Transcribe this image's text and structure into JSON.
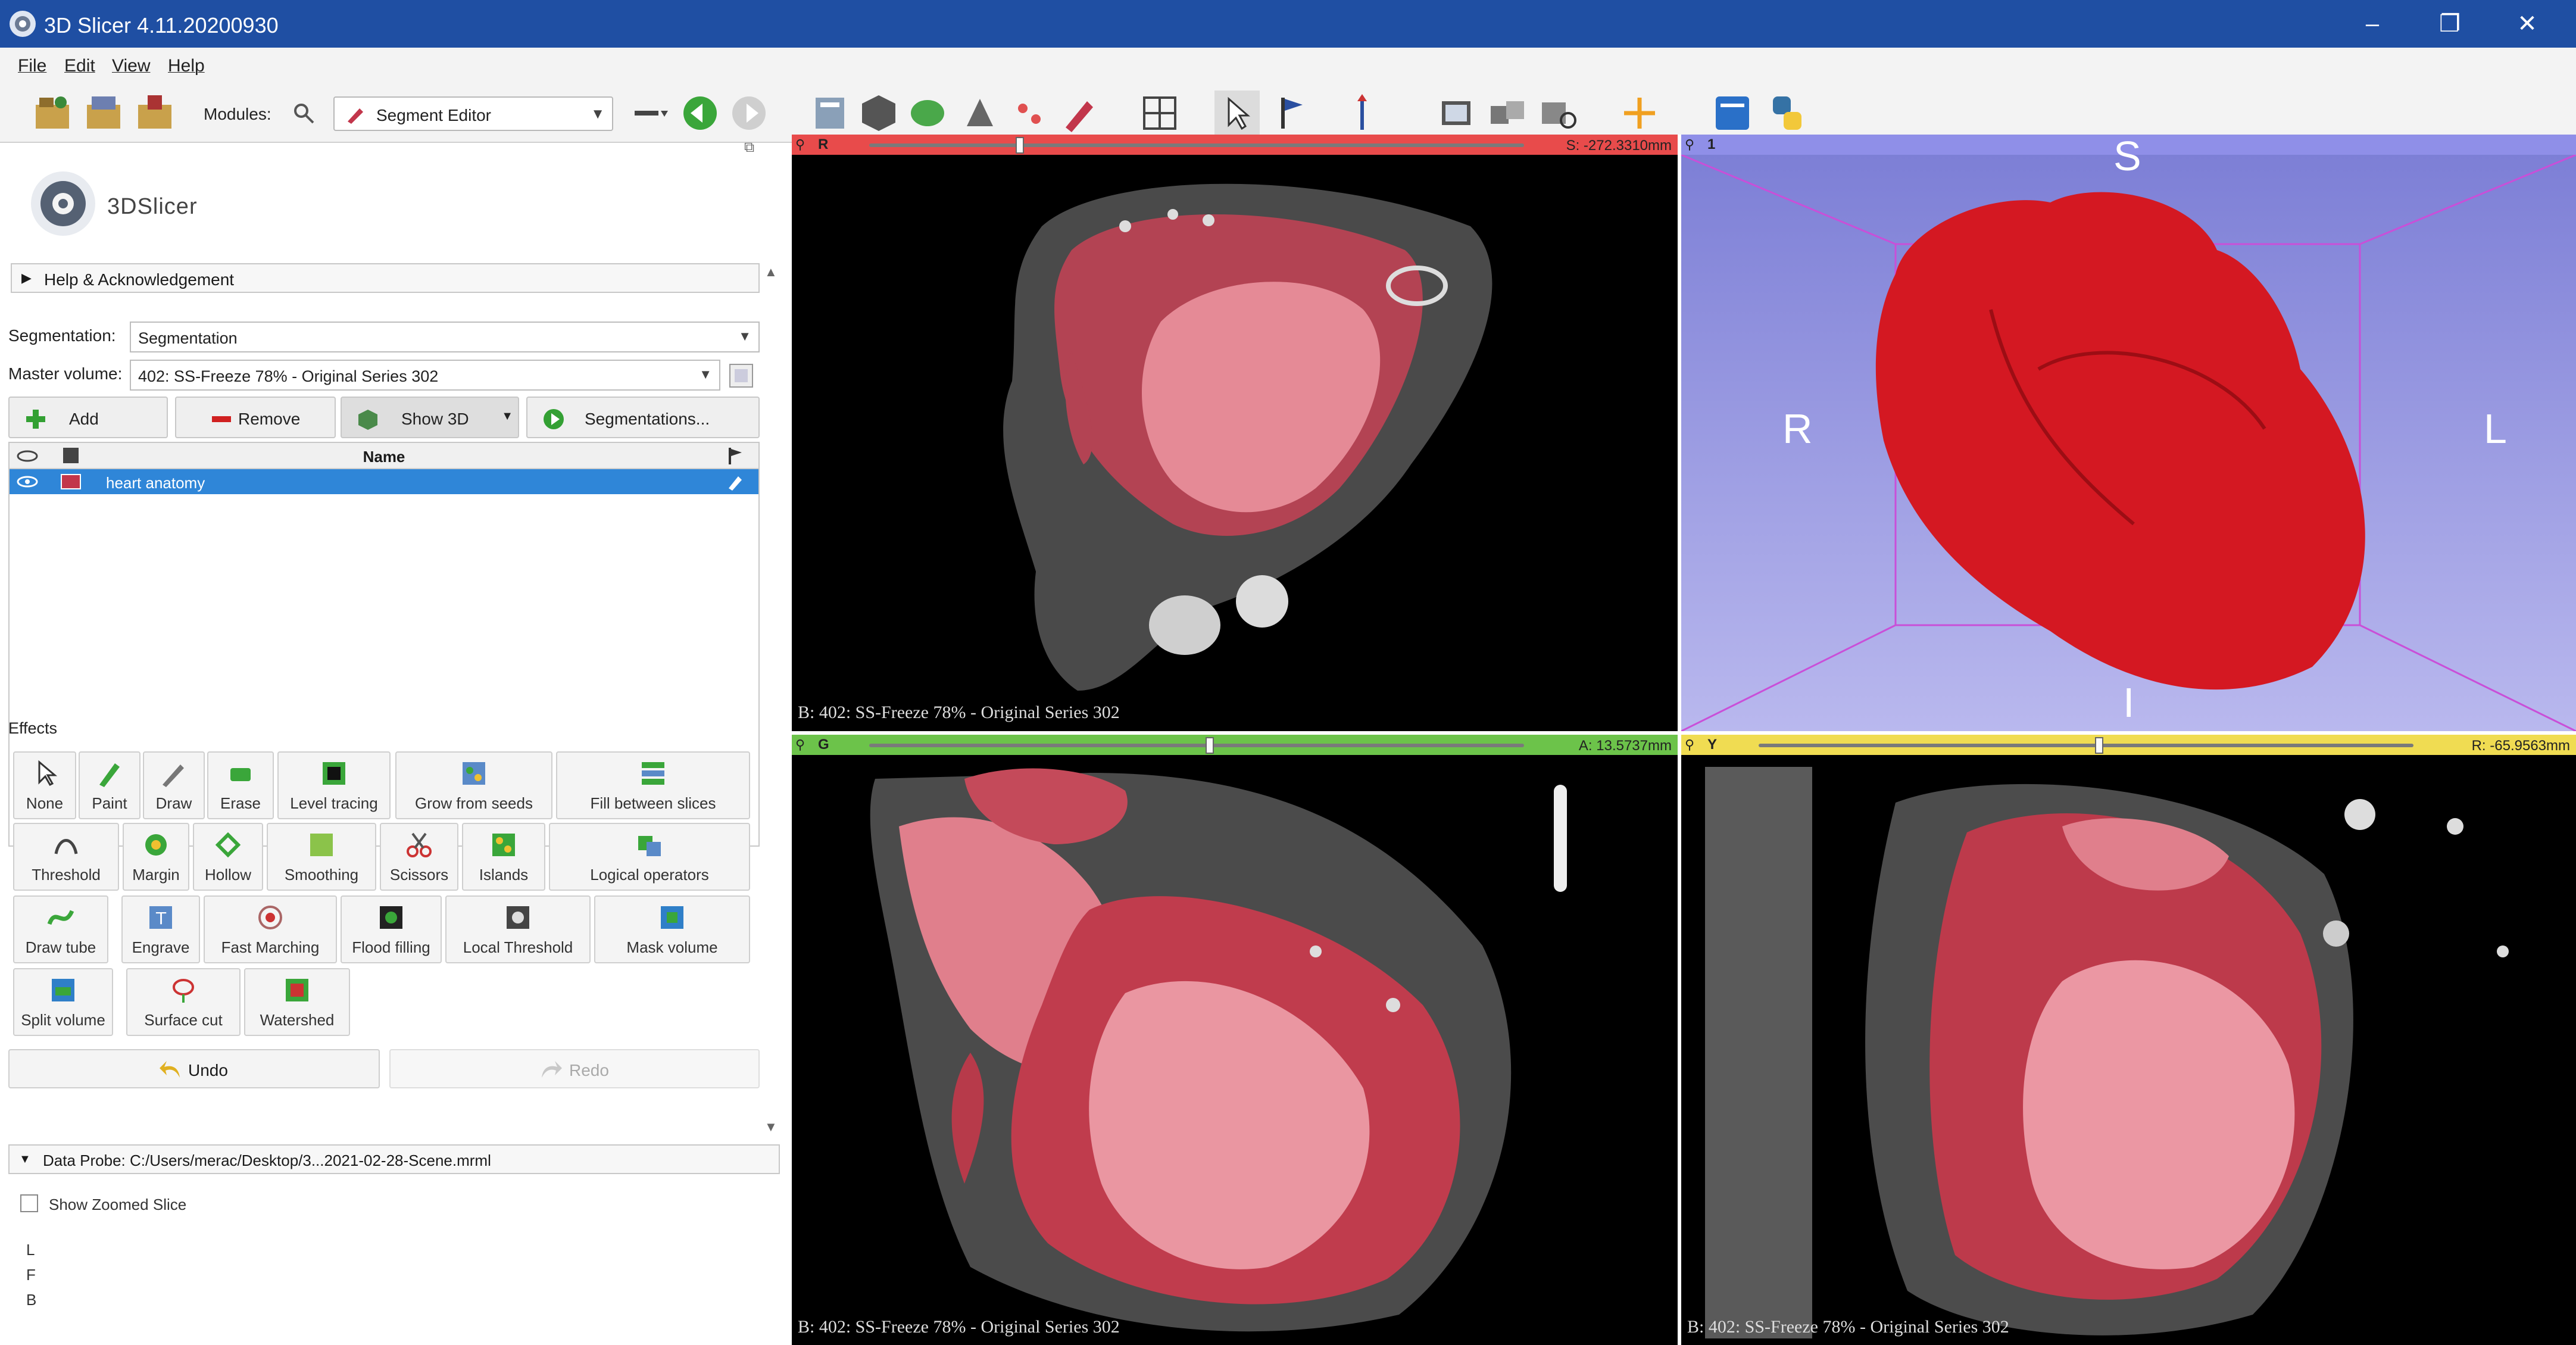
{
  "window": {
    "title": "3D Slicer 4.11.20200930",
    "minimize": "–",
    "maximize": "❐",
    "close": "✕"
  },
  "menu": [
    "File",
    "Edit",
    "View",
    "Help"
  ],
  "toolbar": {
    "modules_label": "Modules:",
    "module_selected": "Segment Editor"
  },
  "logo_text": "3DSlicer",
  "help_section": "Help & Acknowledgement",
  "segmentation": {
    "label": "Segmentation:",
    "value": "Segmentation"
  },
  "master_volume": {
    "label": "Master volume:",
    "value": "402: SS-Freeze 78% - Original Series 302"
  },
  "buttons": {
    "add": "Add",
    "remove": "Remove",
    "show3d": "Show 3D",
    "segmentations": "Segmentations..."
  },
  "segment_table": {
    "column_name": "Name",
    "rows": [
      {
        "name": "heart anatomy",
        "color": "#c2364b"
      }
    ]
  },
  "effects_label": "Effects",
  "effects": [
    {
      "label": "None",
      "icon": "cursor-icon"
    },
    {
      "label": "Paint",
      "icon": "paint-icon"
    },
    {
      "label": "Draw",
      "icon": "draw-icon"
    },
    {
      "label": "Erase",
      "icon": "erase-icon"
    },
    {
      "label": "Level tracing",
      "icon": "level-tracing-icon"
    },
    {
      "label": "Grow from seeds",
      "icon": "grow-seeds-icon"
    },
    {
      "label": "Fill between slices",
      "icon": "fill-slices-icon"
    },
    {
      "label": "Threshold",
      "icon": "threshold-icon"
    },
    {
      "label": "Margin",
      "icon": "margin-icon"
    },
    {
      "label": "Hollow",
      "icon": "hollow-icon"
    },
    {
      "label": "Smoothing",
      "icon": "smoothing-icon"
    },
    {
      "label": "Scissors",
      "icon": "scissors-icon"
    },
    {
      "label": "Islands",
      "icon": "islands-icon"
    },
    {
      "label": "Logical operators",
      "icon": "logical-operators-icon"
    },
    {
      "label": "Draw tube",
      "icon": "draw-tube-icon"
    },
    {
      "label": "Engrave",
      "icon": "engrave-icon"
    },
    {
      "label": "Fast Marching",
      "icon": "fast-marching-icon"
    },
    {
      "label": "Flood filling",
      "icon": "flood-filling-icon"
    },
    {
      "label": "Local Threshold",
      "icon": "local-threshold-icon"
    },
    {
      "label": "Mask volume",
      "icon": "mask-volume-icon"
    },
    {
      "label": "Split volume",
      "icon": "split-volume-icon"
    },
    {
      "label": "Surface cut",
      "icon": "surface-cut-icon"
    },
    {
      "label": "Watershed",
      "icon": "watershed-icon"
    }
  ],
  "undo": "Undo",
  "redo": "Redo",
  "data_probe": "Data Probe: C:/Users/merac/Desktop/3...2021-02-28-Scene.mrml",
  "show_zoomed_slice": "Show Zoomed Slice",
  "probe_coords": [
    "L",
    "F",
    "B"
  ],
  "views": {
    "red": {
      "label": "R",
      "offset": "S: -272.3310mm",
      "caption": "B: 402: SS-Freeze 78% - Original Series 302",
      "bar_color": "#e84b4b",
      "slider": 0.23
    },
    "threeD": {
      "label": "1",
      "bar_color": "#8f8fe8",
      "orient_s": "S",
      "orient_r": "R",
      "orient_l": "L",
      "orient_i": "I"
    },
    "green": {
      "label": "G",
      "offset": "A: 13.5737mm",
      "caption": "B: 402: SS-Freeze 78% - Original Series 302",
      "bar_color": "#6cc34a",
      "slider": 0.52
    },
    "yellow": {
      "label": "Y",
      "offset": "R: -65.9563mm",
      "caption": "B: 402: SS-Freeze 78% - Original Series 302",
      "bar_color": "#f0dc52",
      "slider": 0.52
    }
  },
  "colors": {
    "titlebar": "#1f4fa3",
    "segment": "#c2364b",
    "selection": "#2f86d8"
  }
}
